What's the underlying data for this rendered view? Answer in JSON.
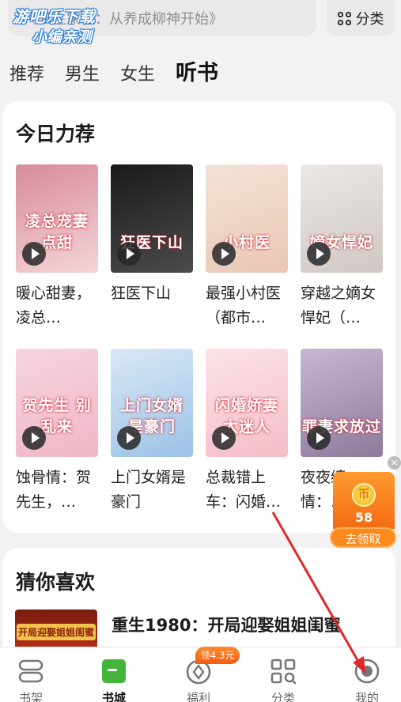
{
  "search": {
    "placeholder": "《长生家祖：从养成柳神开始》"
  },
  "category_button": {
    "label": "分类"
  },
  "watermark": {
    "line1": "游吧乐下载",
    "line2": "小编亲测"
  },
  "tabs": [
    {
      "label": "推荐"
    },
    {
      "label": "男生"
    },
    {
      "label": "女生"
    },
    {
      "label": "听书",
      "active": true
    }
  ],
  "today_section": {
    "title": "今日力荐",
    "books": [
      {
        "title": "暖心甜妻，凌总…",
        "cover_text": "凌总宠妻 点甜",
        "colors": [
          "#d88b9c",
          "#f3d5d7"
        ]
      },
      {
        "title": "狂医下山",
        "cover_text": "狂医下山",
        "colors": [
          "#1a1a1a",
          "#4b4b4b"
        ]
      },
      {
        "title": "最强小村医（都市…",
        "cover_text": "小村医",
        "colors": [
          "#f4e3d8",
          "#e9c7b4"
        ]
      },
      {
        "title": "穿越之嫡女悍妃（…",
        "cover_text": "嫡女悍妃",
        "colors": [
          "#ece8e6",
          "#cfc7c3"
        ]
      },
      {
        "title": "蚀骨情：贺先生，…",
        "cover_text": "贺先生 别乱来",
        "colors": [
          "#f6d5df",
          "#f0b6c6"
        ]
      },
      {
        "title": "上门女婿是豪门",
        "cover_text": "上门女婿 是豪门",
        "colors": [
          "#d9e8f6",
          "#9cc2e6"
        ]
      },
      {
        "title": "总裁错上车：闪婚…",
        "cover_text": "闪婚娇妻 太迷人",
        "colors": [
          "#fbe3e8",
          "#f4bdc8"
        ]
      },
      {
        "title": "夜夜缠情：…",
        "cover_text": "罪妻求放过",
        "colors": [
          "#c9b6d2",
          "#8d7a9c"
        ]
      }
    ]
  },
  "guess_section": {
    "title": "猜你喜欢",
    "book_title": "重生1980：开局迎娶姐姐闺蜜",
    "cover_text": "开局迎娶姐姐闺蜜"
  },
  "reward": {
    "coin_icon": "币",
    "amount": "58",
    "action": "去领取",
    "close": "×"
  },
  "bottom_nav": {
    "items": [
      {
        "label": "书架"
      },
      {
        "label": "书城",
        "active": true
      },
      {
        "label": "福利"
      },
      {
        "label": "分类"
      },
      {
        "label": "我的"
      }
    ],
    "badge": "领4.3元"
  },
  "colors": {
    "accent": "#f36b12",
    "annotation_arrow": "#e0282b",
    "active_tab_icon": "#43b53a"
  }
}
